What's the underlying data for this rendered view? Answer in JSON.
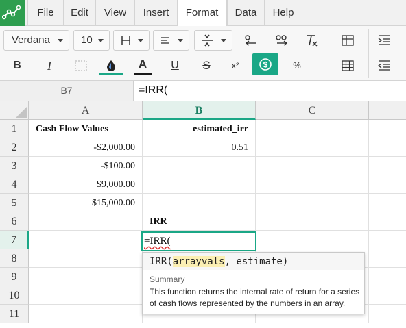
{
  "menu": {
    "items": [
      "File",
      "Edit",
      "View",
      "Insert",
      "Format",
      "Data",
      "Help"
    ],
    "active": "Format"
  },
  "toolbar": {
    "font_family": "Verdana",
    "font_size": "10",
    "icons": [
      "borders-icon",
      "align-icon",
      "valign-icon",
      "decrease-decimals-icon",
      "increase-decimals-icon",
      "clear-format-icon",
      "table-icon",
      "indent-icon",
      "bold-icon",
      "italic-icon",
      "merge-icon",
      "fill-color-icon",
      "text-color-icon",
      "underline-icon",
      "strikethrough-icon",
      "superscript-icon",
      "currency-icon",
      "percent-icon",
      "grid-icon",
      "outdent-icon"
    ],
    "bold_label": "B",
    "italic_label": "I",
    "textcolor_label": "A",
    "underline_label": "U",
    "strike_label": "S",
    "superscript_label": "x²",
    "percent_label": "%",
    "fill_color": "#1aa786",
    "text_color": "#1a1a1a",
    "accent_color": "#1aa786"
  },
  "formula_bar": {
    "cell_ref": "B7",
    "formula": "=IRR("
  },
  "grid": {
    "columns": [
      "A",
      "B",
      "C"
    ],
    "selected_column": "B",
    "rows": [
      "1",
      "2",
      "3",
      "4",
      "5",
      "6",
      "7",
      "8",
      "9",
      "10",
      "11"
    ],
    "selected_row": "7",
    "cells": {
      "A1": "Cash Flow Values",
      "B1": "estimated_irr",
      "A2": "-$2,000.00",
      "B2": "0.51",
      "A3": "-$100.00",
      "A4": "$9,000.00",
      "A5": "$15,000.00",
      "B6": "IRR"
    },
    "active_cell_text": "=IRR("
  },
  "autocomplete": {
    "fn": "IRR(",
    "arg_highlight": "arrayvals",
    "rest": ", estimate)",
    "summary_title": "Summary",
    "summary_text": "This function returns the internal rate of return for a series of cash flows represented by the numbers in an array."
  }
}
